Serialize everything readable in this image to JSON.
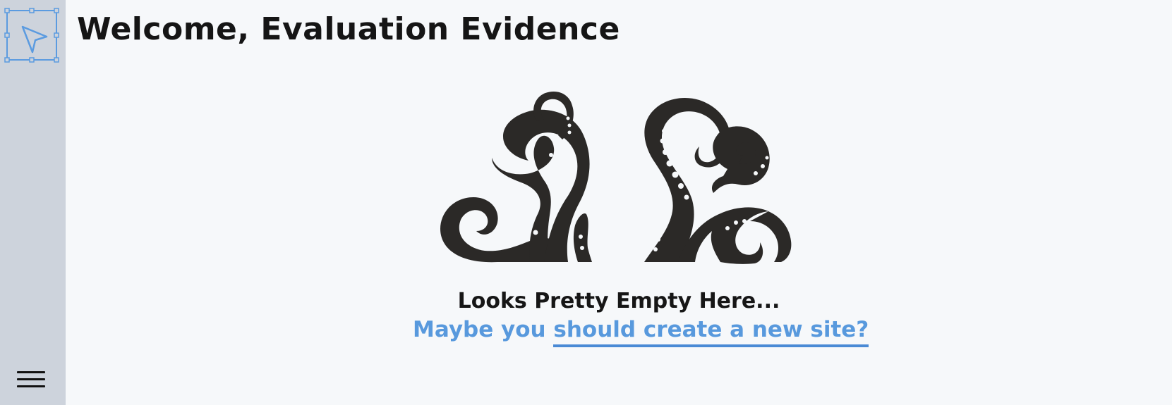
{
  "sidebar": {
    "logo_icon": "cursor-select-icon",
    "menu_icon": "hamburger-menu-icon"
  },
  "header": {
    "title": "Welcome, Evaluation Evidence"
  },
  "empty_state": {
    "illustration": "octopus-tentacles-illustration",
    "title": "Looks Pretty Empty Here...",
    "prompt_prefix": "Maybe you ",
    "link_label": "should create a new site?"
  },
  "colors": {
    "sidebar_bg": "#cdd3dc",
    "page_bg": "#f6f8fa",
    "accent": "#5899dd",
    "text": "#151515",
    "illustration": "#2b2927"
  }
}
